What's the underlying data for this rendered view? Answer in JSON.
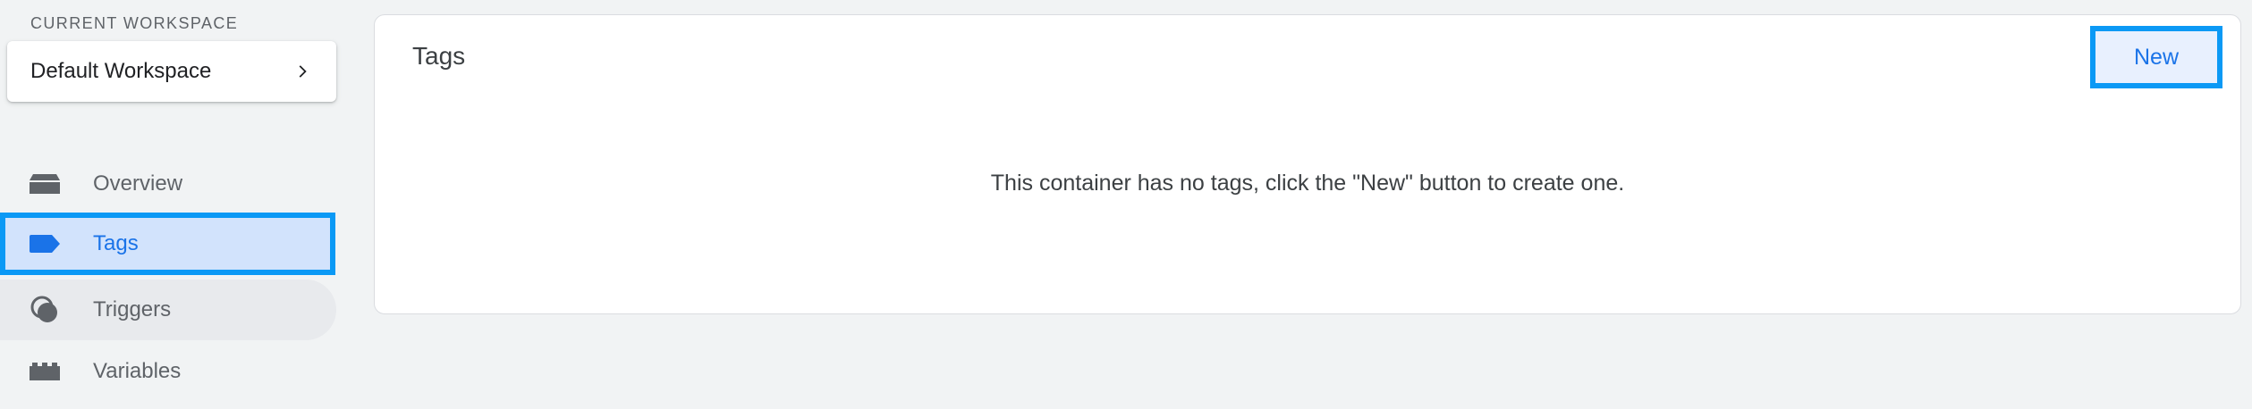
{
  "workspace": {
    "section_label": "CURRENT WORKSPACE",
    "name": "Default Workspace"
  },
  "sidebar": {
    "items": [
      {
        "label": "Overview",
        "icon": "overview-icon",
        "active": false
      },
      {
        "label": "Tags",
        "icon": "tag-icon",
        "active": true
      },
      {
        "label": "Triggers",
        "icon": "trigger-icon",
        "active": false
      },
      {
        "label": "Variables",
        "icon": "variables-icon",
        "active": false
      }
    ]
  },
  "main": {
    "title": "Tags",
    "new_button_label": "New",
    "empty_message": "This container has no tags, click the \"New\" button to create one."
  },
  "colors": {
    "accent": "#1a73e8",
    "highlight_border": "#0b99f5",
    "active_bg": "#d2e3fc",
    "page_bg": "#f1f3f4"
  }
}
